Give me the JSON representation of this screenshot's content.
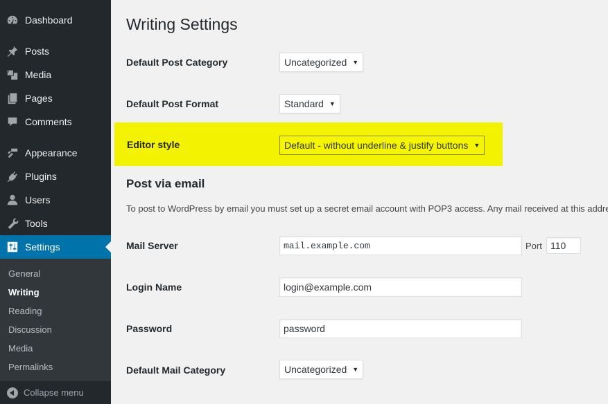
{
  "sidebar": {
    "items": [
      {
        "label": "Dashboard",
        "icon": "dashboard-icon"
      },
      {
        "label": "Posts",
        "icon": "pin-icon"
      },
      {
        "label": "Media",
        "icon": "media-icon"
      },
      {
        "label": "Pages",
        "icon": "pages-icon"
      },
      {
        "label": "Comments",
        "icon": "comment-icon"
      },
      {
        "label": "Appearance",
        "icon": "paintbrush-icon"
      },
      {
        "label": "Plugins",
        "icon": "plug-icon"
      },
      {
        "label": "Users",
        "icon": "user-icon"
      },
      {
        "label": "Tools",
        "icon": "wrench-icon"
      },
      {
        "label": "Settings",
        "icon": "settings-sliders-icon",
        "active": true
      }
    ],
    "submenu": [
      {
        "label": "General"
      },
      {
        "label": "Writing",
        "current": true
      },
      {
        "label": "Reading"
      },
      {
        "label": "Discussion"
      },
      {
        "label": "Media"
      },
      {
        "label": "Permalinks"
      }
    ],
    "collapse_label": "Collapse menu"
  },
  "main": {
    "title": "Writing Settings",
    "fields": {
      "default_post_category": {
        "label": "Default Post Category",
        "value": "Uncategorized"
      },
      "default_post_format": {
        "label": "Default Post Format",
        "value": "Standard"
      },
      "editor_style": {
        "label": "Editor style",
        "value": "Default - without underline & justify buttons"
      }
    },
    "post_via_email": {
      "title": "Post via email",
      "description": "To post to WordPress by email you must set up a secret email account with POP3 access. Any mail received at this address",
      "mail_server": {
        "label": "Mail Server",
        "value": "mail.example.com"
      },
      "port": {
        "label": "Port",
        "value": "110"
      },
      "login_name": {
        "label": "Login Name",
        "value": "login@example.com"
      },
      "password": {
        "label": "Password",
        "value": "password"
      },
      "default_mail_category": {
        "label": "Default Mail Category",
        "value": "Uncategorized"
      }
    }
  },
  "colors": {
    "sidebar_bg": "#23282d",
    "submenu_bg": "#32373c",
    "active_bg": "#0073aa",
    "highlight": "#f3f200",
    "page_bg": "#f1f1f1"
  }
}
